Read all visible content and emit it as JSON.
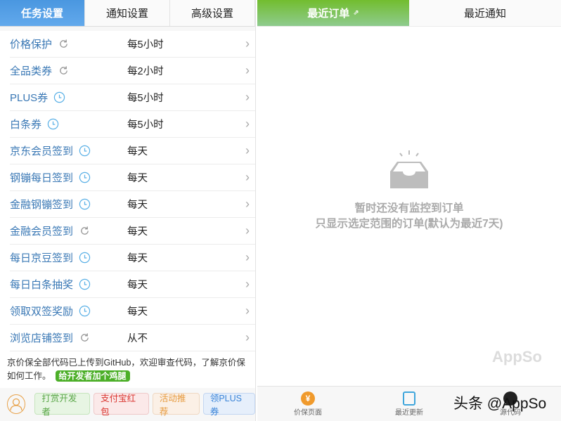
{
  "left": {
    "tabs": [
      {
        "label": "任务设置",
        "active": true
      },
      {
        "label": "通知设置",
        "active": false
      },
      {
        "label": "高级设置",
        "active": false
      }
    ],
    "rows": [
      {
        "name": "价格保护",
        "icon": "refresh",
        "value": "每5小时"
      },
      {
        "name": "全品类券",
        "icon": "refresh",
        "value": "每2小时"
      },
      {
        "name": "PLUS券",
        "icon": "clock",
        "value": "每5小时"
      },
      {
        "name": "白条券",
        "icon": "clock",
        "value": "每5小时"
      },
      {
        "name": "京东会员签到",
        "icon": "clock",
        "value": "每天"
      },
      {
        "name": "钢镚每日签到",
        "icon": "clock",
        "value": "每天"
      },
      {
        "name": "金融钢镚签到",
        "icon": "clock",
        "value": "每天"
      },
      {
        "name": "金融会员签到",
        "icon": "refresh",
        "value": "每天"
      },
      {
        "name": "每日京豆签到",
        "icon": "clock",
        "value": "每天"
      },
      {
        "name": "每日白条抽奖",
        "icon": "clock",
        "value": "每天"
      },
      {
        "name": "领取双签奖励",
        "icon": "clock",
        "value": "每天"
      },
      {
        "name": "浏览店铺签到",
        "icon": "refresh",
        "value": "从不"
      }
    ],
    "info_text": "京价保全部代码已上传到GitHub，欢迎审查代码，了解京价保如何工作。",
    "donate_label": "给开发者加个鸡腿",
    "buttons": [
      "打赏开发者",
      "支付宝红包",
      "活动推荐",
      "领PLUS券"
    ]
  },
  "right": {
    "tabs": [
      {
        "label": "最近订单",
        "active": true
      },
      {
        "label": "最近通知",
        "active": false
      }
    ],
    "empty_title": "暂时还没有监控到订单",
    "empty_sub": "只显示选定范围的订单(默认为最近7天)",
    "nav": [
      {
        "label": "价保页面",
        "icon": "yen-icon"
      },
      {
        "label": "最近更新",
        "icon": "changelog-icon"
      },
      {
        "label": "源代码",
        "icon": "github-icon"
      }
    ]
  },
  "watermark": "头条 @AppSo",
  "watermark_faint": "AppSo"
}
